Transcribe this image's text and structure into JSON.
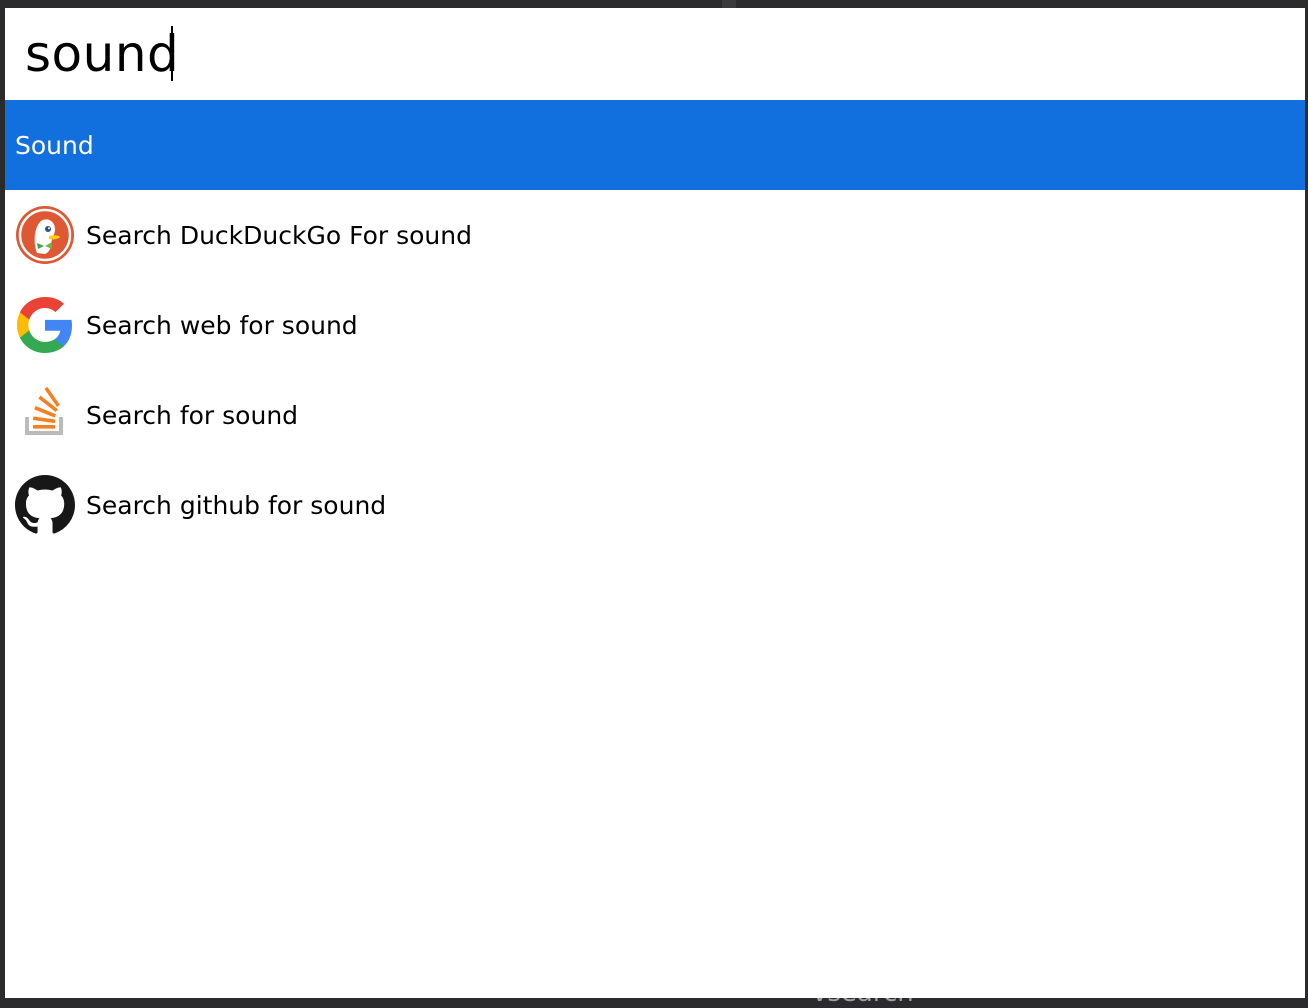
{
  "search": {
    "query": "sound"
  },
  "results": [
    {
      "label": "Sound",
      "selected": true
    },
    {
      "label": "Search DuckDuckGo For sound",
      "icon": "duckduckgo-icon"
    },
    {
      "label": "Search web for sound",
      "icon": "google-icon"
    },
    {
      "label": "Search for sound",
      "icon": "stackoverflow-icon"
    },
    {
      "label": "Search github for sound",
      "icon": "github-icon"
    }
  ],
  "background": {
    "bottom_fragment": "vsearch"
  },
  "colors": {
    "selection": "#126fde",
    "desktop": "#2b2b2e"
  }
}
